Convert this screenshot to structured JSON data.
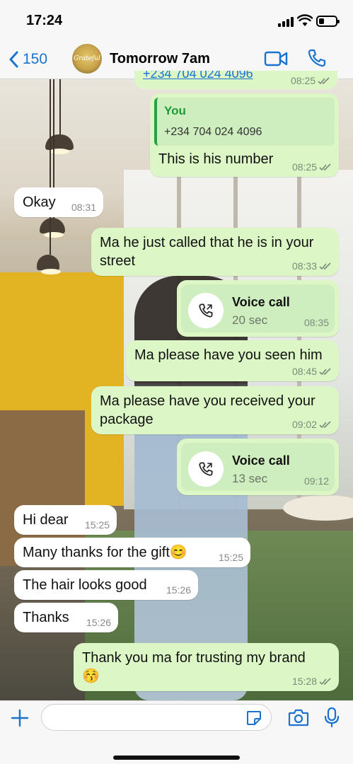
{
  "status_bar": {
    "time": "17:24"
  },
  "header": {
    "back_count": "150",
    "avatar_text": "Grateful",
    "chat_title": "Tomorrow 7am"
  },
  "messages": [
    {
      "type": "partial-link",
      "text": "+234 704 024 4096",
      "time": "08:25"
    },
    {
      "type": "out",
      "reply_author": "You",
      "reply_text": "+234 704 024 4096",
      "text": "This is his number",
      "time": "08:25"
    },
    {
      "type": "in",
      "text": "Okay",
      "time": "08:31"
    },
    {
      "type": "out",
      "text": "Ma he just called that he is in your street",
      "time": "08:33"
    },
    {
      "type": "call",
      "title": "Voice call",
      "duration": "20 sec",
      "time": "08:35"
    },
    {
      "type": "out",
      "text": "Ma please have you seen him",
      "time": "08:45"
    },
    {
      "type": "out",
      "text": "Ma please have you received your package",
      "time": "09:02"
    },
    {
      "type": "call",
      "title": "Voice call",
      "duration": "13 sec",
      "time": "09:12"
    },
    {
      "type": "in",
      "text": "Hi dear",
      "time": "15:25"
    },
    {
      "type": "in",
      "text": "Many thanks for the gift😊",
      "time": "15:25"
    },
    {
      "type": "in",
      "text": "The hair looks good",
      "time": "15:26"
    },
    {
      "type": "in",
      "text": "Thanks",
      "time": "15:26"
    },
    {
      "type": "out",
      "text": "Thank you ma for trusting my brand 😚",
      "time": "15:28"
    }
  ],
  "composer": {
    "placeholder": ""
  },
  "icons": {
    "back": "chevron-left-icon",
    "video": "video-camera-icon",
    "call": "phone-icon",
    "plus": "plus-icon",
    "sticker": "sticker-icon",
    "camera": "camera-icon",
    "mic": "microphone-icon",
    "voice_call": "phone-call-icon",
    "read": "double-check-icon"
  },
  "colors": {
    "accent": "#1a73d0",
    "outgoing_bubble": "#dcf7c5",
    "incoming_bubble": "#ffffff",
    "reply_bar": "#25a244"
  }
}
